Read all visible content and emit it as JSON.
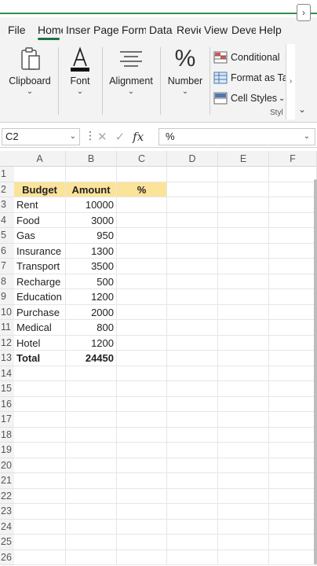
{
  "tabs": [
    {
      "label": "File",
      "w": 38
    },
    {
      "label": "Home",
      "w": 36,
      "active": true
    },
    {
      "label": "Insert",
      "w": 35
    },
    {
      "label": "Page",
      "w": 36
    },
    {
      "label": "Form",
      "w": 35
    },
    {
      "label": "Data",
      "w": 35
    },
    {
      "label": "Review",
      "w": 35
    },
    {
      "label": "View",
      "w": 35
    },
    {
      "label": "Deve",
      "w": 35
    },
    {
      "label": "Help",
      "w": 35
    }
  ],
  "ribbon": {
    "clipboard": "Clipboard",
    "font": "Font",
    "alignment": "Alignment",
    "number": "Number",
    "conditional": "Conditional",
    "format_as_table": "Format as Ta",
    "cell_styles": "Cell Styles",
    "styles_group": "Styl"
  },
  "formula_bar": {
    "name_box": "C2",
    "formula": "%"
  },
  "columns": [
    "A",
    "B",
    "C",
    "D",
    "E",
    "F"
  ],
  "rows": [
    {
      "n": "1",
      "a": "",
      "b": "",
      "c": ""
    },
    {
      "n": "2",
      "a": "Budget",
      "b": "Amount",
      "c": "%",
      "header": true
    },
    {
      "n": "3",
      "a": "Rent",
      "b": "10000",
      "c": ""
    },
    {
      "n": "4",
      "a": "Food",
      "b": "3000",
      "c": ""
    },
    {
      "n": "5",
      "a": "Gas",
      "b": "950",
      "c": ""
    },
    {
      "n": "6",
      "a": "Insurance",
      "b": "1300",
      "c": ""
    },
    {
      "n": "7",
      "a": "Transport",
      "b": "3500",
      "c": ""
    },
    {
      "n": "8",
      "a": "Recharge",
      "b": "500",
      "c": ""
    },
    {
      "n": "9",
      "a": "Education",
      "b": "1200",
      "c": ""
    },
    {
      "n": "10",
      "a": "Purchase",
      "b": "2000",
      "c": ""
    },
    {
      "n": "11",
      "a": "Medical",
      "b": "800",
      "c": ""
    },
    {
      "n": "12",
      "a": "Hotel",
      "b": "1200",
      "c": ""
    },
    {
      "n": "13",
      "a": "Total",
      "b": "24450",
      "c": "",
      "total": true
    },
    {
      "n": "14"
    },
    {
      "n": "15"
    },
    {
      "n": "16"
    },
    {
      "n": "17"
    },
    {
      "n": "18"
    },
    {
      "n": "19"
    },
    {
      "n": "20"
    },
    {
      "n": "21"
    },
    {
      "n": "22"
    },
    {
      "n": "23"
    },
    {
      "n": "24"
    },
    {
      "n": "25"
    },
    {
      "n": "26"
    }
  ],
  "colors": {
    "accent": "#1e7145",
    "header_fill": "#fbe39a"
  }
}
